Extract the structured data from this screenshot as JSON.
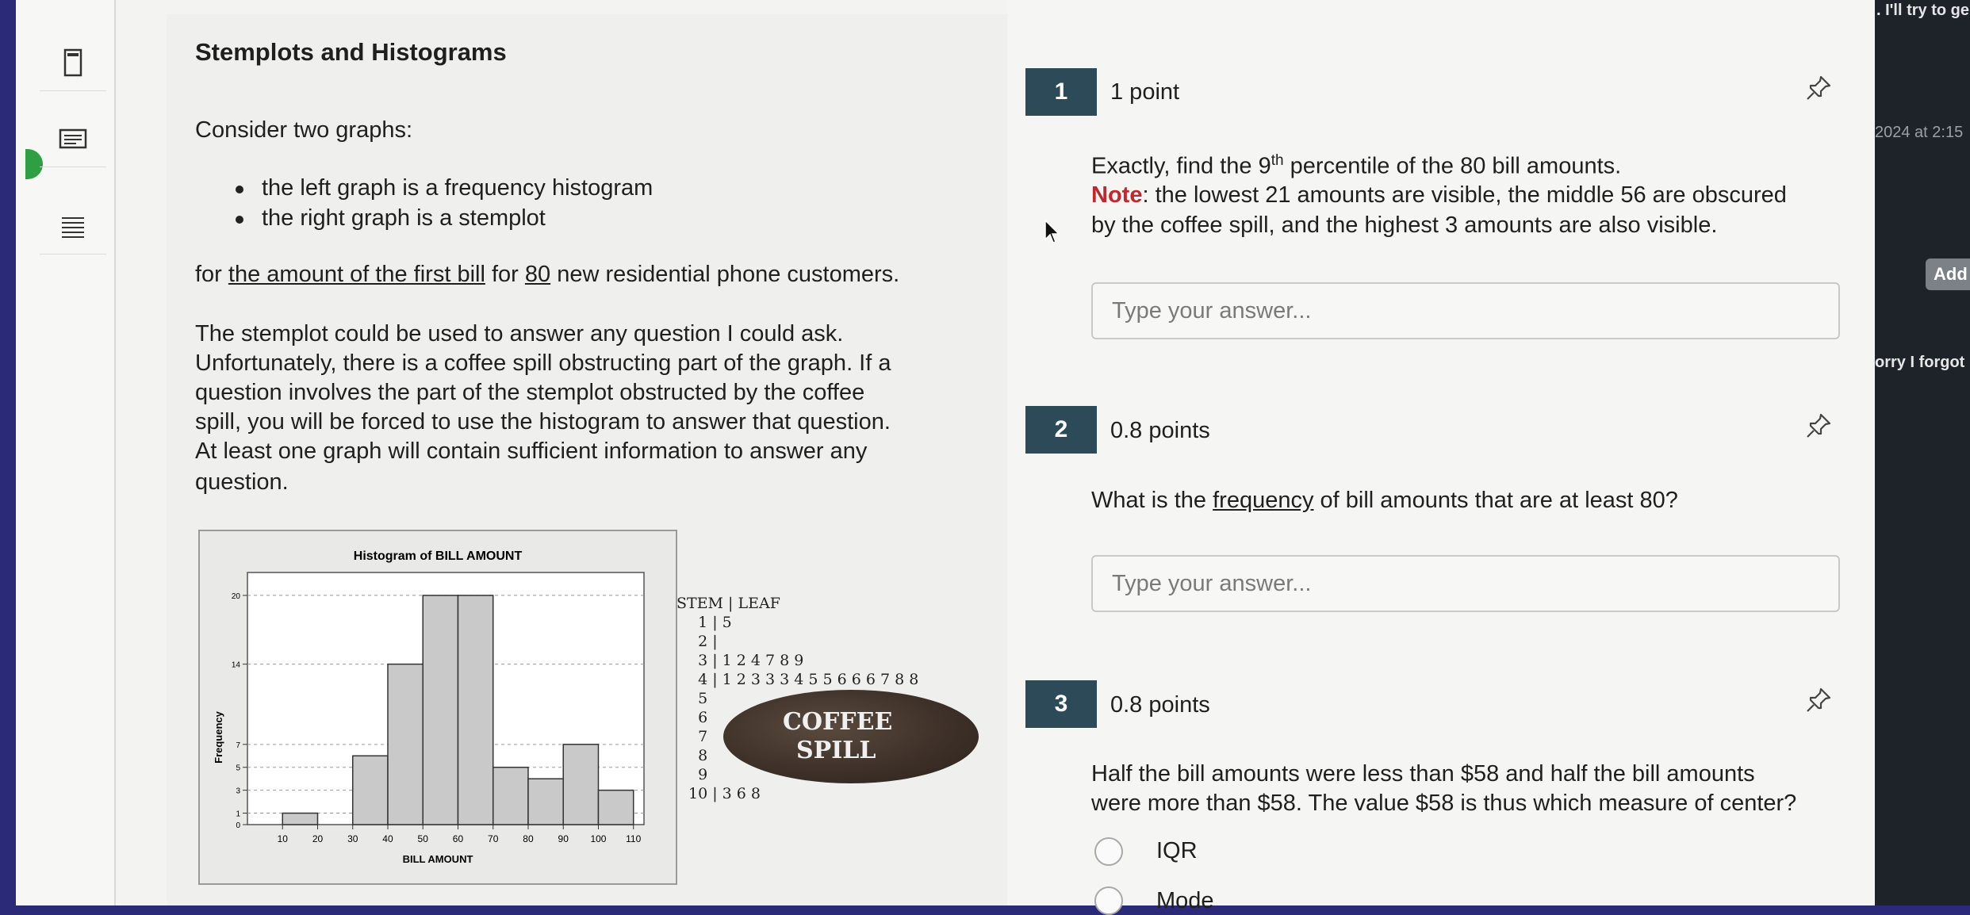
{
  "strip": {
    "top_text": ". I'll try to ge",
    "date_text": "2024 at 2:15",
    "add_label": "Add",
    "sorry_text": "orry I forgot"
  },
  "toolbar": {
    "icons": [
      "page-icon",
      "note-icon",
      "text-lines-icon"
    ]
  },
  "intro": {
    "title": "Stemplots and Histograms",
    "consider": "Consider two graphs:",
    "bullet1": "the left graph is a frequency histogram",
    "bullet2": "the right graph is a stemplot",
    "for_prefix": "for ",
    "for_link": "the amount of the first bill",
    "for_mid": " for ",
    "for_num": "80",
    "for_suffix": " new residential phone customers.",
    "para_lines": [
      "The stemplot could be used to answer any question I could ask.",
      "Unfortunately, there is a coffee spill obstructing part of the graph.  If a",
      "question involves the part of the stemplot obstructed by the coffee",
      "spill, you will be forced to use the histogram to answer that question.",
      "At least one graph will contain sufficient information to answer any",
      "question."
    ]
  },
  "histogram": {
    "title": "Histogram of BILL AMOUNT",
    "xlabel": "BILL AMOUNT",
    "ylabel": "Frequency",
    "x_ticks": [
      "10",
      "20",
      "30",
      "40",
      "50",
      "60",
      "70",
      "80",
      "90",
      "100",
      "110"
    ],
    "y_ticks": [
      "0",
      "1",
      "3",
      "5",
      "7",
      "14",
      "20"
    ]
  },
  "chart_data": {
    "type": "bar",
    "title": "Histogram of BILL AMOUNT",
    "xlabel": "BILL AMOUNT",
    "ylabel": "Frequency",
    "bins": [
      [
        10,
        20
      ],
      [
        20,
        30
      ],
      [
        30,
        40
      ],
      [
        40,
        50
      ],
      [
        50,
        60
      ],
      [
        60,
        70
      ],
      [
        70,
        80
      ],
      [
        80,
        90
      ],
      [
        90,
        100
      ],
      [
        100,
        110
      ]
    ],
    "values": [
      1,
      0,
      6,
      14,
      20,
      20,
      5,
      4,
      7,
      3
    ],
    "x_ticks": [
      10,
      20,
      30,
      40,
      50,
      60,
      70,
      80,
      90,
      100,
      110
    ],
    "y_ticks": [
      0,
      1,
      3,
      5,
      7,
      14,
      20
    ],
    "ylim": [
      0,
      22
    ],
    "xlim": [
      0,
      113
    ],
    "grid": true
  },
  "stemplot": {
    "header": "STEM | LEAF",
    "lines": [
      "  1 | 5",
      "  2 |",
      "  3 | 1 2 4 7 8 9",
      "  4 | 1 2 3 3 3 4 5 5 6 6 6 7 8 8",
      "  5",
      "  6",
      "  7",
      "  8",
      "  9",
      "10 | 3 6 8"
    ],
    "spill_line1": "COFFEE",
    "spill_line2": "SPILL"
  },
  "questions": [
    {
      "number": "1",
      "points": "1 point",
      "text_prefix": "Exactly, find the 9",
      "text_sup": "th",
      "text_suffix": " percentile of the 80 bill amounts.",
      "note_label": "Note",
      "note_text": ":  the lowest 21 amounts are visible, the middle 56 are obscured",
      "note_text2": "by the coffee spill, and the highest 3 amounts are also visible.",
      "placeholder": "Type your answer..."
    },
    {
      "number": "2",
      "points": "0.8 points",
      "text_prefix": "What is the ",
      "text_link": "frequency",
      "text_suffix": " of bill amounts that are at least 80?",
      "placeholder": "Type your answer..."
    },
    {
      "number": "3",
      "points": "0.8 points",
      "line1": "Half the bill amounts were less than $58 and half the bill amounts",
      "line2": "were more than $58.  The value $58 is thus which measure of center?",
      "options": [
        "IQR",
        "Mode"
      ]
    }
  ]
}
